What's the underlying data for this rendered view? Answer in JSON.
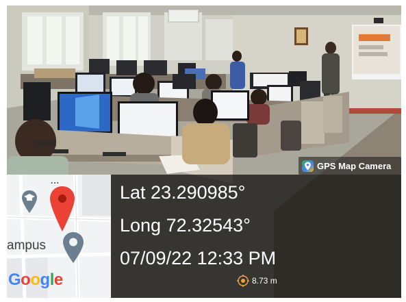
{
  "app": {
    "badge_label": "GPS Map Camera",
    "badge_icon": "location-pin-map-icon"
  },
  "location": {
    "lat": "Lat 23.290985°",
    "long": "Long 72.32543°",
    "datetime": "07/09/22 12:33 PM",
    "accuracy": "8.73 m"
  },
  "map": {
    "more_menu": "...",
    "place_label": "ampus",
    "logo": [
      "G",
      "o",
      "o",
      "g",
      "l",
      "e"
    ],
    "logo_colors": [
      "#4285f4",
      "#ea4335",
      "#fbbc05",
      "#4285f4",
      "#34a853",
      "#ea4335"
    ],
    "pin_color": "#ea4335",
    "poi_color": "#6b7f90"
  }
}
